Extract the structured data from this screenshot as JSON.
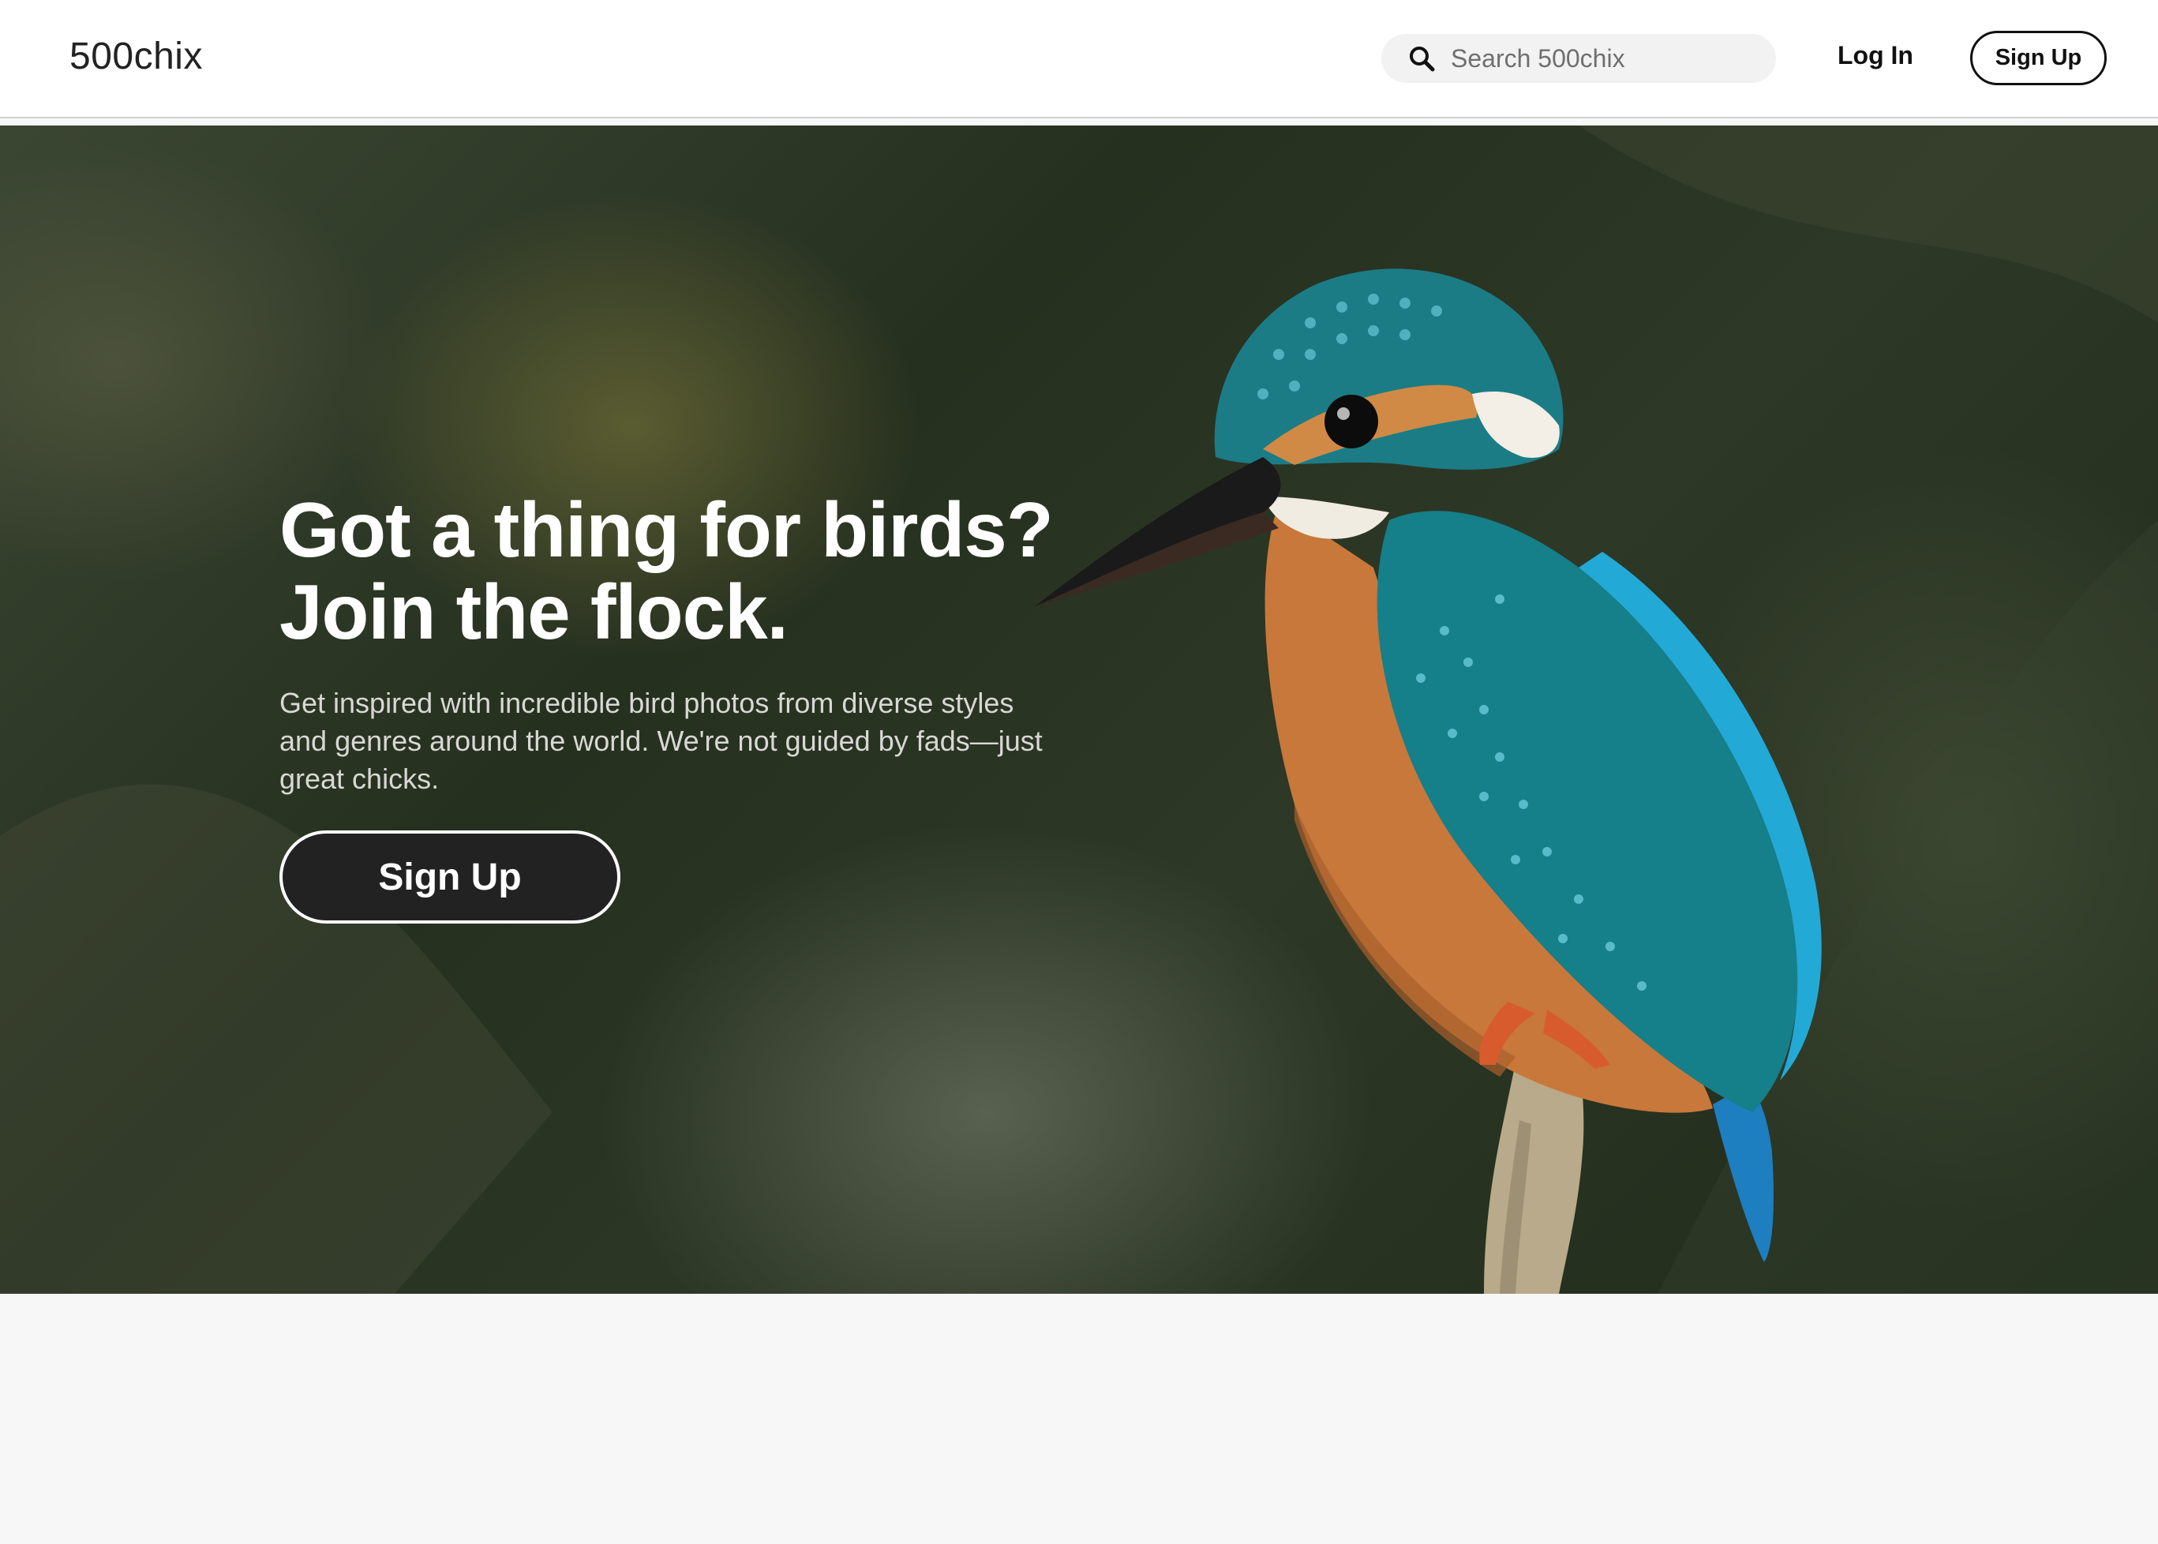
{
  "header": {
    "logo": "500chix",
    "search": {
      "placeholder": "Search 500chix",
      "icon": "search-icon"
    },
    "login_label": "Log In",
    "signup_label": "Sign Up"
  },
  "hero": {
    "title_line1": "Got a thing for birds?",
    "title_line2": "Join the flock.",
    "subtitle": "Get inspired with incredible bird photos from diverse styles and genres around the world. We're not guided by fads—just great chicks.",
    "cta_label": "Sign Up"
  },
  "colors": {
    "header_bg": "#ffffff",
    "page_bg": "#f7f7f7",
    "cta_bg": "#222222",
    "hero_bg": "#2e3826"
  }
}
